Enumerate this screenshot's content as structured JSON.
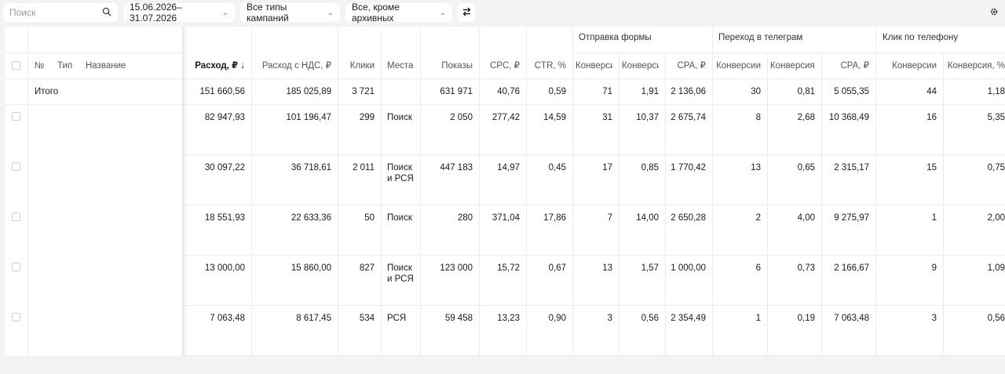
{
  "toolbar": {
    "search_placeholder": "Поиск",
    "date_range": "15.06.2026–31.07.2026",
    "campaign_types": "Все типы кампаний",
    "status_filter": "Все, кроме архивных"
  },
  "columns": {
    "num": "№",
    "type": "Тип",
    "name": "Название",
    "spend": "Расход, ₽ ↓",
    "spend_vat": "Расход с НДС, ₽",
    "clicks": "Клики",
    "places": "Места",
    "impressions": "Показы",
    "cpc": "CPC, ₽",
    "ctr": "CTR, %",
    "conv": "Конверсии",
    "conv_rate": "Конверсия, %",
    "cpa": "CPA, ₽"
  },
  "groups": {
    "form": "Отправка формы",
    "telegram": "Переход в телеграм",
    "phone": "Клик по телефону"
  },
  "total_label": "Итого",
  "rows": [
    {
      "spend": "151 660,56",
      "spend_vat": "185 025,89",
      "clicks": "3 721",
      "places": "",
      "impressions": "631 971",
      "cpc": "40,76",
      "ctr": "0,59",
      "f_conv": "71",
      "f_rate": "1,91",
      "f_cpa": "2 136,06",
      "t_conv": "30",
      "t_rate": "0,81",
      "t_cpa": "5 055,35",
      "p_conv": "44",
      "p_rate": "1,18"
    },
    {
      "spend": "82 947,93",
      "spend_vat": "101 196,47",
      "clicks": "299",
      "places": "Поиск",
      "impressions": "2 050",
      "cpc": "277,42",
      "ctr": "14,59",
      "f_conv": "31",
      "f_rate": "10,37",
      "f_cpa": "2 675,74",
      "t_conv": "8",
      "t_rate": "2,68",
      "t_cpa": "10 368,49",
      "p_conv": "16",
      "p_rate": "5,35"
    },
    {
      "spend": "30 097,22",
      "spend_vat": "36 718,61",
      "clicks": "2 011",
      "places": "Поиск\nи РСЯ",
      "impressions": "447 183",
      "cpc": "14,97",
      "ctr": "0,45",
      "f_conv": "17",
      "f_rate": "0,85",
      "f_cpa": "1 770,42",
      "t_conv": "13",
      "t_rate": "0,65",
      "t_cpa": "2 315,17",
      "p_conv": "15",
      "p_rate": "0,75"
    },
    {
      "spend": "18 551,93",
      "spend_vat": "22 633,36",
      "clicks": "50",
      "places": "Поиск",
      "impressions": "280",
      "cpc": "371,04",
      "ctr": "17,86",
      "f_conv": "7",
      "f_rate": "14,00",
      "f_cpa": "2 650,28",
      "t_conv": "2",
      "t_rate": "4,00",
      "t_cpa": "9 275,97",
      "p_conv": "1",
      "p_rate": "2,00"
    },
    {
      "spend": "13 000,00",
      "spend_vat": "15 860,00",
      "clicks": "827",
      "places": "Поиск\nи РСЯ",
      "impressions": "123 000",
      "cpc": "15,72",
      "ctr": "0,67",
      "f_conv": "13",
      "f_rate": "1,57",
      "f_cpa": "1 000,00",
      "t_conv": "6",
      "t_rate": "0,73",
      "t_cpa": "2 166,67",
      "p_conv": "9",
      "p_rate": "1,09"
    },
    {
      "spend": "7 063,48",
      "spend_vat": "8 617,45",
      "clicks": "534",
      "places": "РСЯ",
      "impressions": "59 458",
      "cpc": "13,23",
      "ctr": "0,90",
      "f_conv": "3",
      "f_rate": "0,56",
      "f_cpa": "2 354,49",
      "t_conv": "1",
      "t_rate": "0,19",
      "t_cpa": "7 063,48",
      "p_conv": "3",
      "p_rate": "0,56"
    }
  ]
}
